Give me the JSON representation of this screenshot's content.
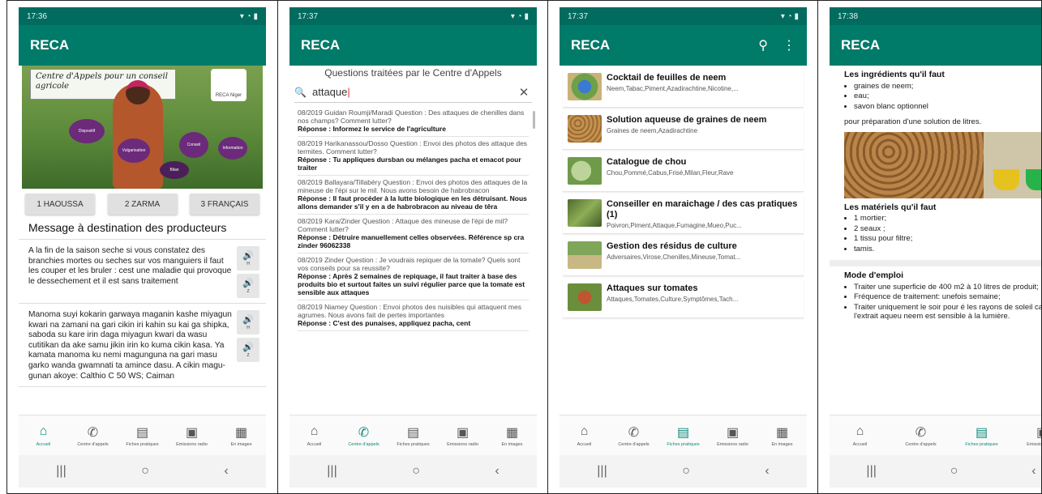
{
  "app": {
    "title": "RECA"
  },
  "screens": [
    {
      "status_time": "17:36",
      "hero": {
        "banner": "Centre d'Appels pour un conseil agricole",
        "logo_text": "RECA Niger",
        "bubbles": [
          "Dispositif",
          "Vulgarisation",
          "Conseil",
          "Information",
          "Bilan"
        ]
      },
      "languages": [
        "1 HAOUSSA",
        "2 ZARMA",
        "3 FRANÇAIS"
      ],
      "section_title": "Message à destination des producteurs",
      "messages": [
        {
          "text": "A la fin de la saison seche si vous constatez des branchies mortes ou seches sur vos manguiers il faut les couper et les bruler : cest une maladie qui provoque le dessechement et il est sans traitement",
          "buttons": [
            "H",
            "Z"
          ]
        },
        {
          "text": "Manoma suyi kokarin garwaya maganin kashe miyagun kwari na zamani na gari cikin iri kahin su kai ga shipka, saboda su kare irin daga miyagun kwari da wasu cutitikan da ake samu jikin irin ko kuma cikin kasa. Ya kamata manoma ku nemi magunguna na gari masu garko wanda gwamnati ta amince dasu. A cikin magu-gunan akoye: Calthio C 50 WS; Caiman",
          "buttons": [
            "H",
            "Z"
          ]
        }
      ],
      "nav_active": 0
    },
    {
      "status_time": "17:37",
      "header": "Questions traitées par le Centre d'Appels",
      "search": {
        "value": "attaque"
      },
      "questions": [
        {
          "q": "08/2019 Guidan Roumji/Maradi Question : Des attaques de chenilles dans nos champs? Comment lutter?",
          "r": "Réponse : Informez le service de l'agriculture"
        },
        {
          "q": "08/2019 Harikanassou/Dosso Question : Envoi des photos des attaque des termites. Comment lutter?",
          "r": "Réponse : Tu appliques dursban ou mélanges pacha et emacot pour traiter"
        },
        {
          "q": "08/2019 Ballayara/Tillabéry Question : Envoi des photos des attaques de la mineuse de l'épi sur le mil. Nous avons besoin de habrobracon",
          "r": "Réponse : Il faut procéder à la lutte biologique en les détruisant. Nous allons demander s'il y en a de habrobracon au niveau de têra"
        },
        {
          "q": "08/2019 Kara/Zinder Question : Attaque des mineuse de l'épi de mil? Comment lutter?",
          "r": "Réponse : Détruire manuellement celles observées. Référence sp cra zinder 96062338"
        },
        {
          "q": "08/2019 Zinder Question : Je voudrais repiquer de la tomate? Quels sont vos conseils pour sa reussite?",
          "r": "Réponse : Après 2 semaines de repiquage, il faut traiter à base des produits bio et surtout faites un suivi régulier parce que la tomate est sensible aux attaques"
        },
        {
          "q": "08/2019 Niamey Question : Envoi photos des nuisibles qui attaquent mes agrumes. Nous avons fait de pertes importantes",
          "r": "Réponse : C'est des punaises, appliquez pacha, cent"
        }
      ],
      "nav_active": 1
    },
    {
      "status_time": "17:37",
      "cards": [
        {
          "title": "Cocktail de feuilles de neem",
          "sub": "Neem,Tabac,Piment,Azadirachtine,Nicotine,..."
        },
        {
          "title": "Solution aqueuse de graines de neem",
          "sub": "Graines de neem,Azadirachtine"
        },
        {
          "title": "Catalogue de chou",
          "sub": "Chou,Pommé,Cabus,Frisé,Milan,Fleur,Rave"
        },
        {
          "title": "Conseiller en maraichage / des cas pratiques (1)",
          "sub": "Poivron,Piment,Attaque,Fumagine,Mueo,Puc..."
        },
        {
          "title": "Gestion des résidus de culture",
          "sub": "Adversaires,Virose,Chenilles,Mineuse,Tomat..."
        },
        {
          "title": "Attaques sur tomates",
          "sub": "Attaques,Tomates,Culture,Symptômes,Tach..."
        }
      ],
      "nav_active": 2
    },
    {
      "status_time": "17:38",
      "ingredients_title": "Les ingrédients qu'il faut",
      "ingredients": [
        "graines de neem;",
        "eau;",
        "savon blanc optionnel"
      ],
      "prep_text": "pour préparation d'une solution de litres.",
      "materials_title": "Les matériels qu'il faut",
      "materials": [
        "1 mortier;",
        "2 seaux ;",
        "1 tissu pour filtre;",
        "tamis."
      ],
      "usage_title": "Mode d'emploi",
      "usage": [
        "Traiter une superficie de 400 m2 à 10 litres de produit;",
        "Fréquence de traitement: unefois semaine;",
        "Traiter uniquement le soir pour é les rayons de soleil car l'extrait aqueu neem est sensible à la lumière."
      ],
      "nav_active": 2
    }
  ],
  "nav_labels": [
    "Accueil",
    "Centre d'appels",
    "Fiches pratiques",
    "Emissions radio",
    "En images"
  ],
  "colors": {
    "appbar": "#007a69",
    "status": "#006b5e",
    "accent": "#0a8a78"
  }
}
